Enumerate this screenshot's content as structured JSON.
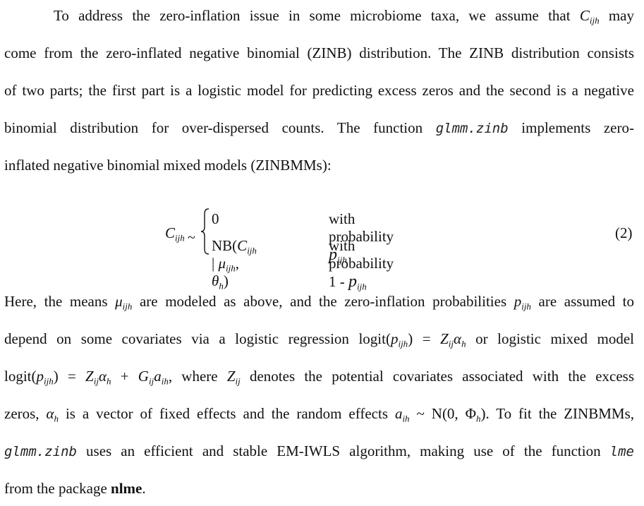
{
  "paragraph1": {
    "line1": {
      "before": "To address the zero-inflation issue in some microbiome taxa, we assume that ",
      "var": "C",
      "sub": "ijh",
      "after": " may"
    },
    "line2": "come from the zero-inflated negative binomial (ZINB) distribution. The ZINB distribution consists",
    "line3": "of two parts; the first part is a logistic model for predicting excess zeros and the second is a negative",
    "line4": {
      "before": "binomial distribution for over-dispersed counts. The function ",
      "code": "glmm.zinb",
      "after": " implements zero-"
    },
    "line5": "inflated negative binomial mixed models (ZINBMMs):"
  },
  "equation": {
    "lhs": "C",
    "lhs_sub": "ijh",
    "sim": "~",
    "case1_value": "0",
    "case1_cond": "with probability ",
    "case1_p": "p",
    "case1_p_sub": "ijh",
    "case2_value_pre": "NB(",
    "case2_C": "C",
    "case2_C_sub": "ijh",
    "case2_bar": " | ",
    "case2_mu": "μ",
    "case2_mu_sub": "ijh",
    "case2_comma": ", ",
    "case2_theta": "θ",
    "case2_theta_sub": "h",
    "case2_close": ")",
    "case2_cond": "with probability 1 - ",
    "case2_p": "p",
    "case2_p_sub": "ijh",
    "number": "(2)"
  },
  "paragraph2": {
    "line1": {
      "t1": "Here, the means ",
      "mu": "μ",
      "mu_sub": "ijh",
      "t2": " are modeled as above, and the zero-inflation probabilities ",
      "p": "p",
      "p_sub": "ijh",
      "t3": " are assumed to"
    },
    "line2": {
      "t1": "depend on some covariates via a logistic regression logit(",
      "p": "p",
      "p_sub": "ijh",
      "t2": ") = ",
      "Z": "Z",
      "Z_sub": "ij",
      "alpha": "α",
      "alpha_sub": "h",
      "t3": " or logistic mixed model"
    },
    "line3": {
      "t1": "logit(",
      "p": "p",
      "p_sub": "ijh",
      "t2": ") = ",
      "Z": "Z",
      "Z_sub": "ij",
      "alpha": "α",
      "alpha_sub": "h",
      "t3": " + ",
      "G": "G",
      "G_sub": "ij",
      "a": "a",
      "a_sub": "ih",
      "t4": ", where ",
      "Z2": "Z",
      "Z2_sub": "ij",
      "t5": " denotes the potential covariates associated with the excess"
    },
    "line4": {
      "t1": "zeros, ",
      "alpha": "α",
      "alpha_sub": "h",
      "t2": " is a vector of fixed effects and the random effects ",
      "a": "a",
      "a_sub": "ih",
      "t3": " ~ N(0, ",
      "Phi": "Φ",
      "Phi_sub": "h",
      "t4": "). To fit the ZINBMMs,"
    },
    "line5": {
      "code1": "glmm.zinb",
      "t1": "  uses an efficient and stable EM-IWLS algorithm, making use of the function  ",
      "code2": "lme"
    },
    "line6": {
      "t1": "from the package ",
      "bold": "nlme",
      "t2": "."
    }
  }
}
